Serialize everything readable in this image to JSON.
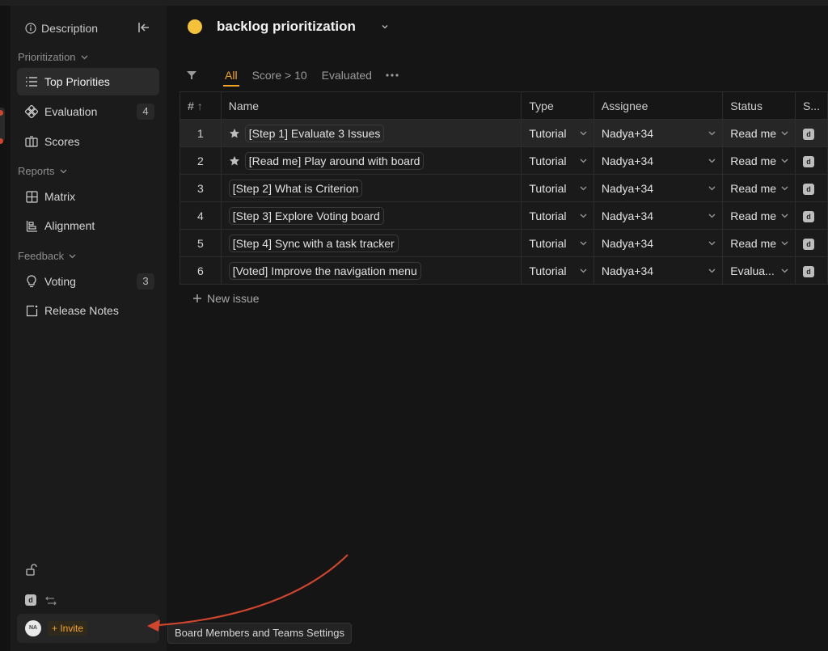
{
  "sidebar": {
    "description_label": "Description",
    "sections": {
      "prioritization": "Prioritization",
      "reports": "Reports",
      "feedback": "Feedback"
    },
    "items": [
      {
        "label": "Top Priorities",
        "badge": ""
      },
      {
        "label": "Evaluation",
        "badge": "4"
      },
      {
        "label": "Scores",
        "badge": ""
      },
      {
        "label": "Matrix",
        "badge": ""
      },
      {
        "label": "Alignment",
        "badge": ""
      },
      {
        "label": "Voting",
        "badge": "3"
      },
      {
        "label": "Release Notes",
        "badge": ""
      }
    ],
    "footer": {
      "avatar_initials": "NA",
      "invite_label": "+ Invite"
    }
  },
  "board": {
    "title": "backlog prioritization"
  },
  "views": [
    "All",
    "Score > 10",
    "Evaluated"
  ],
  "table": {
    "headers": {
      "num": "#",
      "name": "Name",
      "type": "Type",
      "assignee": "Assignee",
      "status": "Status",
      "score": "S..."
    },
    "rows": [
      {
        "num": "1",
        "name": "[Step 1] Evaluate 3 Issues",
        "starred": true,
        "type": "Tutorial",
        "assignee": "Nadya+34",
        "status": "Read me"
      },
      {
        "num": "2",
        "name": "[Read me] Play around with board",
        "starred": true,
        "type": "Tutorial",
        "assignee": "Nadya+34",
        "status": "Read me"
      },
      {
        "num": "3",
        "name": "[Step 2] What is Criterion",
        "starred": false,
        "type": "Tutorial",
        "assignee": "Nadya+34",
        "status": "Read me"
      },
      {
        "num": "4",
        "name": "[Step 3] Explore Voting board",
        "starred": false,
        "type": "Tutorial",
        "assignee": "Nadya+34",
        "status": "Read me"
      },
      {
        "num": "5",
        "name": "[Step 4] Sync with a task tracker",
        "starred": false,
        "type": "Tutorial",
        "assignee": "Nadya+34",
        "status": "Read me"
      },
      {
        "num": "6",
        "name": "[Voted] Improve the navigation menu",
        "starred": false,
        "type": "Tutorial",
        "assignee": "Nadya+34",
        "status": "Evalua..."
      }
    ]
  },
  "new_issue_label": "New issue",
  "tooltip": "Board Members and Teams Settings",
  "colors": {
    "accent": "#f5a524",
    "annotation_arrow": "#d0452e"
  }
}
